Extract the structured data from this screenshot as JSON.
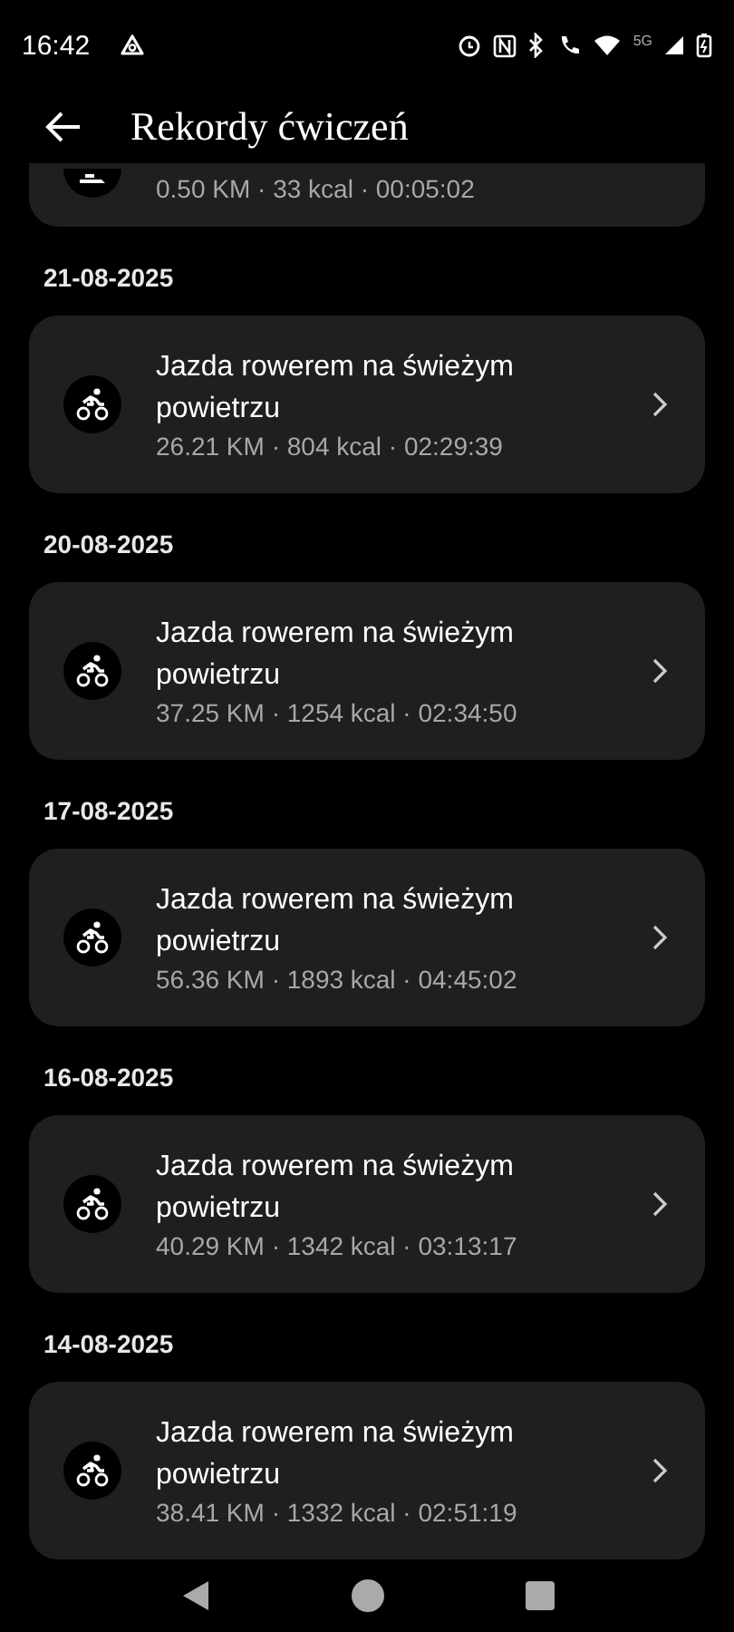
{
  "status_bar": {
    "time": "16:42",
    "network": "5G"
  },
  "header": {
    "title": "Rekordy ćwiczeń"
  },
  "partial_record": {
    "stats": "0.50 KM · 33 kcal · 00:05:02"
  },
  "days": [
    {
      "date": "21-08-2025",
      "record": {
        "title": "Jazda rowerem na świeżym powietrzu",
        "stats": "26.21 KM · 804 kcal · 02:29:39"
      }
    },
    {
      "date": "20-08-2025",
      "record": {
        "title": "Jazda rowerem na świeżym powietrzu",
        "stats": "37.25 KM · 1254 kcal · 02:34:50"
      }
    },
    {
      "date": "17-08-2025",
      "record": {
        "title": "Jazda rowerem na świeżym powietrzu",
        "stats": "56.36 KM · 1893 kcal · 04:45:02"
      }
    },
    {
      "date": "16-08-2025",
      "record": {
        "title": "Jazda rowerem na świeżym powietrzu",
        "stats": "40.29 KM · 1342 kcal · 03:13:17"
      }
    },
    {
      "date": "14-08-2025",
      "record": {
        "title": "Jazda rowerem na świeżym powietrzu",
        "stats": "38.41 KM · 1332 kcal · 02:51:19"
      }
    }
  ]
}
